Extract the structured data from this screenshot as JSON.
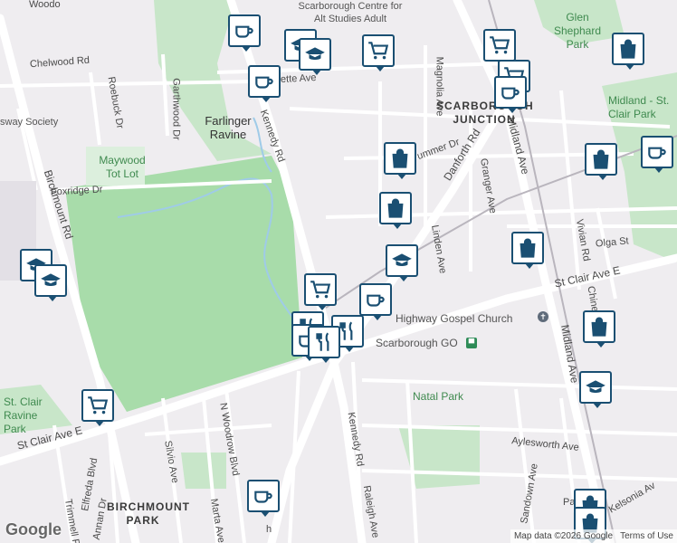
{
  "roads": {
    "kennedy_rd_north": "Kennedy Rd",
    "kennedy_rd_south": "Kennedy Rd",
    "birchmount_rd": "Birchmount Rd",
    "st_clair_west": "St Clair Ave E",
    "st_clair_east": "St Clair Ave E",
    "danforth_rd": "Danforth Rd",
    "midland_ave_north": "Midland Ave",
    "midland_ave_south": "Midland Ave",
    "magnolia_ave": "Magnolia Ave",
    "granger_ave": "Granger Ave",
    "linden_ave": "Linden Ave",
    "chelwood_rd": "Chelwood Rd",
    "roebuck_dr": "Roebuck Dr",
    "garthwood_dr": "Garthwood Dr",
    "foxridge_dr": "Foxridge Dr",
    "ette_ave": "ette Ave",
    "summer_dr": "ummer Dr",
    "n_woodrow_blvd": "N Woodrow Blvd",
    "silvio_ave": "Silvio Ave",
    "elfreda_blvd": "Elfreda Blvd",
    "annan_dr": "Annan Dr",
    "trimmell_rd": "Trimmell Rd",
    "marta_ave": "Marta Ave",
    "raleigh_ave": "Raleigh Ave",
    "aylesworth_ave": "Aylesworth Ave",
    "sandown_ave": "Sandown Ave",
    "vivian_rd": "Vivian Rd",
    "olga_st": "Olga St",
    "chine": "Chine",
    "kelsonia_ave": "Kelsonia Av",
    "pa": "Pa",
    "woodo": "Woodo",
    "rh": "h"
  },
  "places": {
    "farlinger_ravine": "Farlinger Ravine",
    "maywood_tot_lot": "Maywood Tot Lot",
    "glen_shephard_park": "Glen Shephard Park",
    "midland_st_clair_park": "Midland - St. Clair Park",
    "st_clair_ravine_park": "St. Clair Ravine Park",
    "natal_park": "Natal Park",
    "scarborough_junction": "SCARBOROUGH JUNCTION",
    "birchmount_park": "BIRCHMOUNT PARK",
    "highway_gospel_church": "Highway Gospel Church",
    "scarborough_go": "Scarborough GO",
    "scarborough_centre": "Scarborough Centre for Alt Studies Adult",
    "ssway_society": "sway Society"
  },
  "attribution": {
    "google": "Google",
    "map_data": "Map data ©2026 Google",
    "terms": "Terms of Use"
  },
  "colors": {
    "park": "#c8e6c9",
    "park_dark": "#a5d6a7",
    "road_major": "#ffffff",
    "background": "#efedf0",
    "pin_border": "#1a4f72",
    "water": "#9fcbe8"
  },
  "pins": [
    {
      "type": "cafe",
      "icon": "coffee-cup"
    },
    {
      "type": "cafe",
      "icon": "coffee-cup"
    },
    {
      "type": "school",
      "icon": "graduation-cap"
    },
    {
      "type": "school",
      "icon": "graduation-cap"
    },
    {
      "type": "grocery",
      "icon": "shopping-cart"
    },
    {
      "type": "grocery",
      "icon": "shopping-cart"
    },
    {
      "type": "grocery",
      "icon": "shopping-cart"
    },
    {
      "type": "shopping",
      "icon": "shopping-bag"
    },
    {
      "type": "cafe",
      "icon": "coffee-cup"
    },
    {
      "type": "cafe",
      "icon": "coffee-cup"
    },
    {
      "type": "shopping",
      "icon": "shopping-bag"
    },
    {
      "type": "shopping",
      "icon": "shopping-bag"
    },
    {
      "type": "shopping",
      "icon": "shopping-bag"
    },
    {
      "type": "school",
      "icon": "graduation-cap"
    },
    {
      "type": "school",
      "icon": "graduation-cap"
    },
    {
      "type": "school",
      "icon": "graduation-cap"
    },
    {
      "type": "grocery",
      "icon": "shopping-cart"
    },
    {
      "type": "cafe",
      "icon": "coffee-cup"
    },
    {
      "type": "shopping",
      "icon": "shopping-bag"
    },
    {
      "type": "restaurant",
      "icon": "fork-knife"
    },
    {
      "type": "restaurant",
      "icon": "fork-knife"
    },
    {
      "type": "cafe",
      "icon": "coffee-cup"
    },
    {
      "type": "shopping",
      "icon": "shopping-bag"
    },
    {
      "type": "school",
      "icon": "graduation-cap"
    },
    {
      "type": "grocery",
      "icon": "shopping-cart"
    },
    {
      "type": "cafe",
      "icon": "coffee-cup"
    },
    {
      "type": "shopping",
      "icon": "shopping-bag"
    },
    {
      "type": "shopping",
      "icon": "shopping-bag"
    }
  ]
}
